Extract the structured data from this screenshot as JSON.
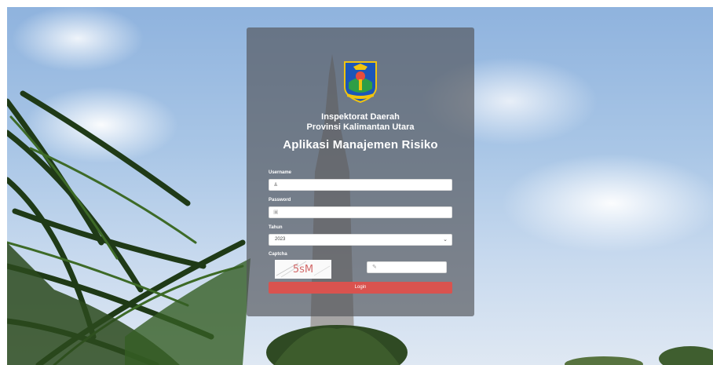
{
  "header": {
    "org_line1": "Inspektorat Daerah",
    "org_line2": "Provinsi Kalimantan Utara",
    "app_title": "Aplikasi Manajemen Risiko"
  },
  "form": {
    "username_label": "Username",
    "username_value": "",
    "password_label": "Password",
    "password_value": "",
    "tahun_label": "Tahun",
    "tahun_value": "2023",
    "captcha_label": "Captcha",
    "captcha_text": "5sM",
    "captcha_value": "",
    "login_label": "Login"
  },
  "icons": {
    "username": "user-icon",
    "password": "lock-icon",
    "captcha": "pencil-icon",
    "select": "chevron-down-icon"
  },
  "colors": {
    "login_button": "#d9534f",
    "panel": "#525458",
    "captcha_text": "#d36a6a"
  }
}
